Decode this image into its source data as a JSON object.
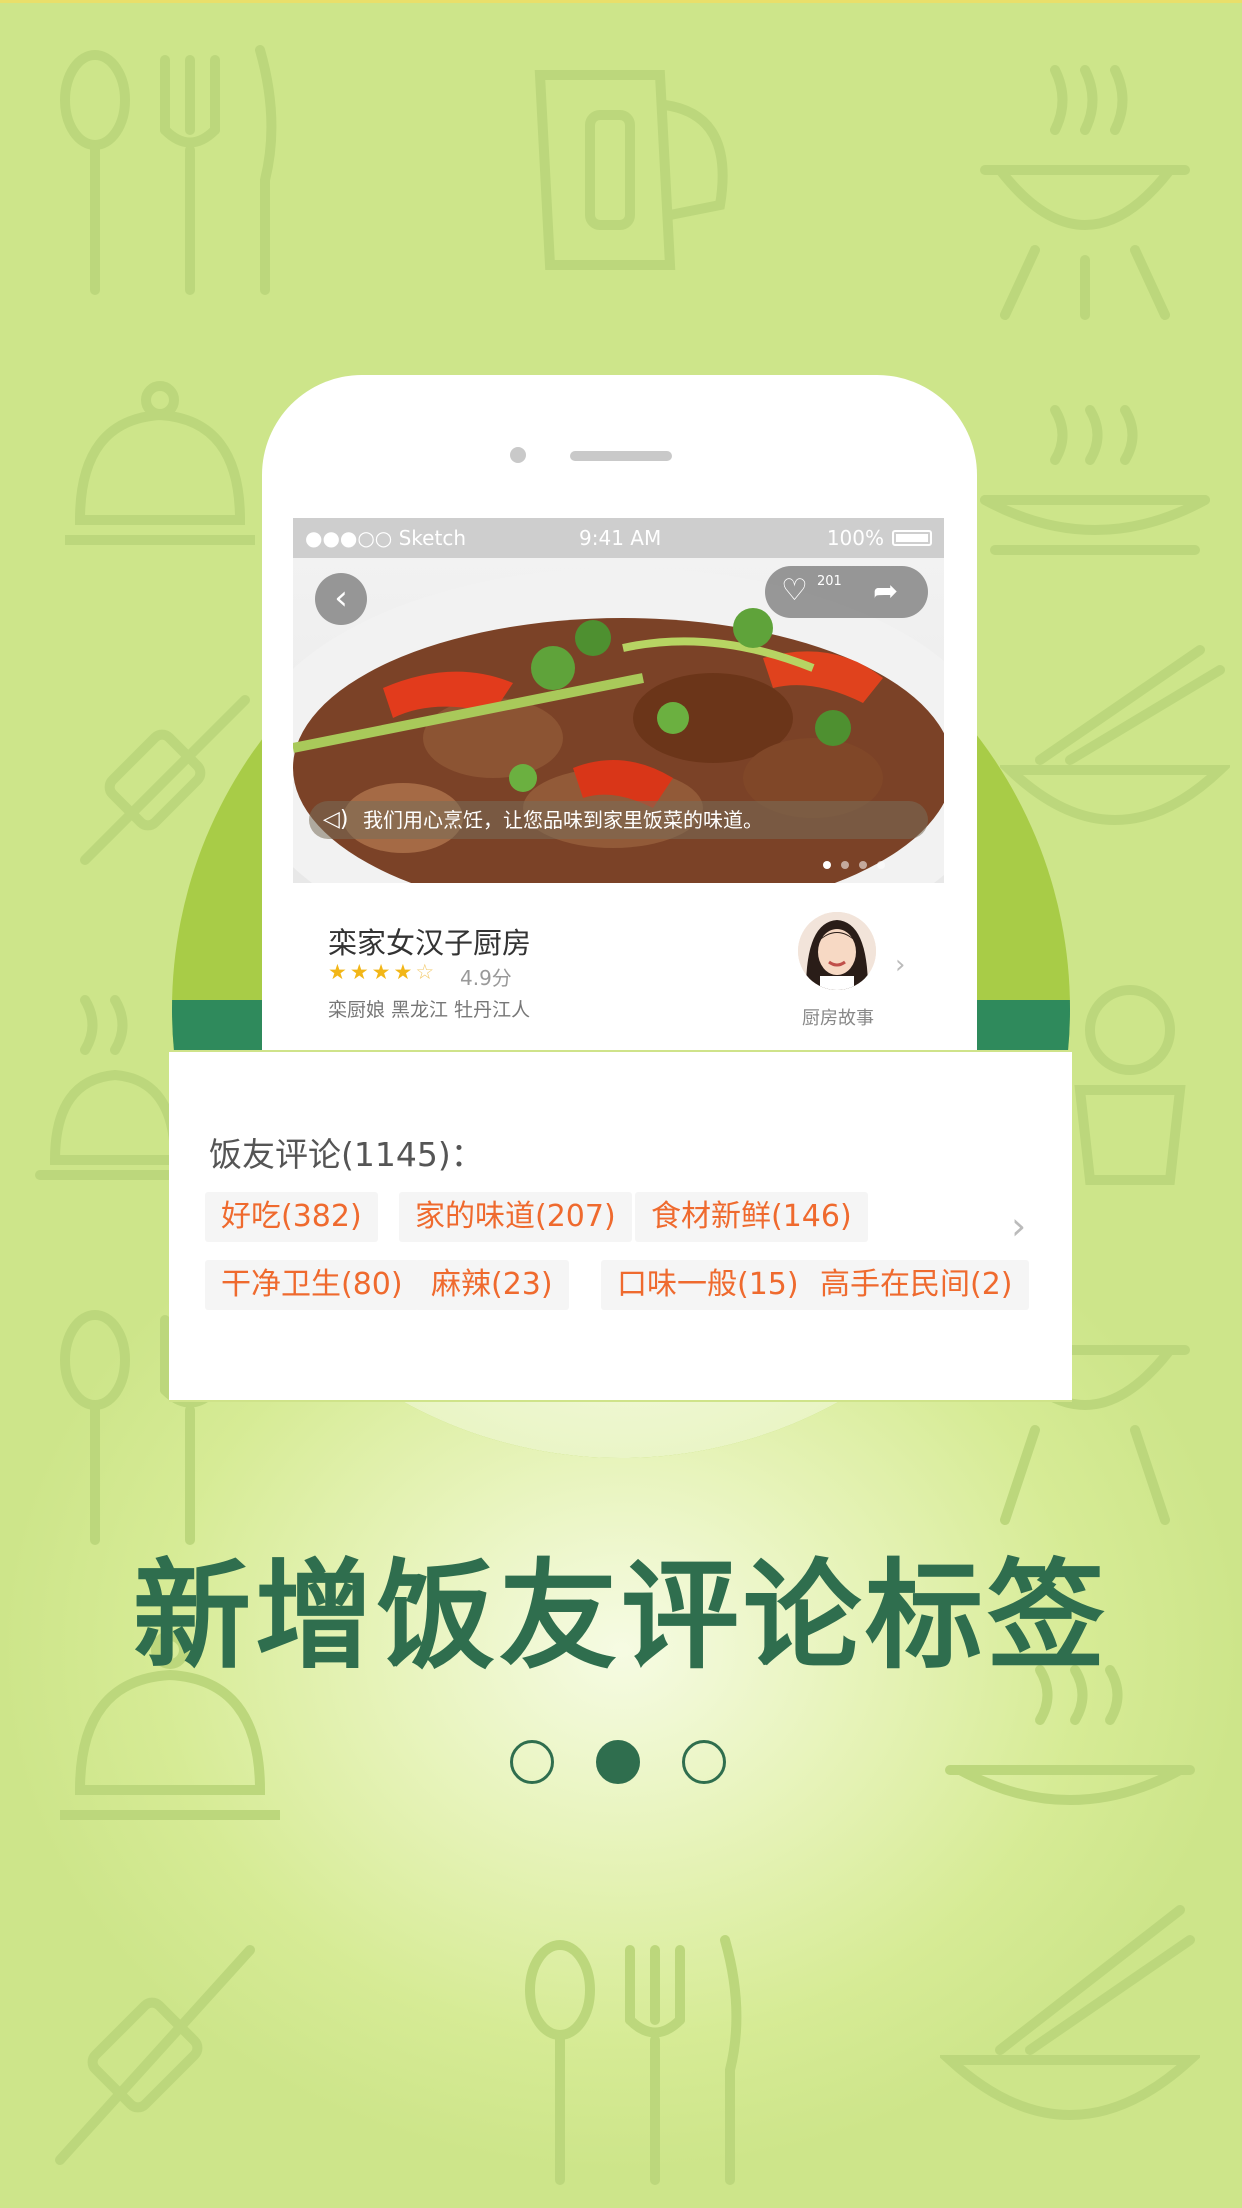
{
  "status_bar": {
    "carrier": "●●●○○ Sketch",
    "time": "9:41 AM",
    "battery": "100%"
  },
  "photo": {
    "like_count": "201",
    "caption": "我们用心烹饪，让您品味到家里饭菜的味道。"
  },
  "restaurant": {
    "name": "栾家女汉子厨房",
    "stars_on": "★★★★",
    "stars_off": "☆",
    "rating": "4.9分",
    "location": "栾厨娘   黑龙江 牡丹江人",
    "story_label": "厨房故事"
  },
  "reviews": {
    "title": "饭友评论(1145)：",
    "tags": [
      "好吃(382)",
      "家的味道(207)",
      "食材新鲜(146)",
      "干净卫生(80)",
      "麻辣(23)",
      "口味一般(15)",
      "高手在民间(2)"
    ]
  },
  "headline": "新增饭友评论标签",
  "pagination": {
    "total": 3,
    "active": 2
  },
  "colors": {
    "accent_green": "#2f6e4e",
    "tag_orange": "#ef6a2e",
    "disc_green": "#a8cc47"
  }
}
